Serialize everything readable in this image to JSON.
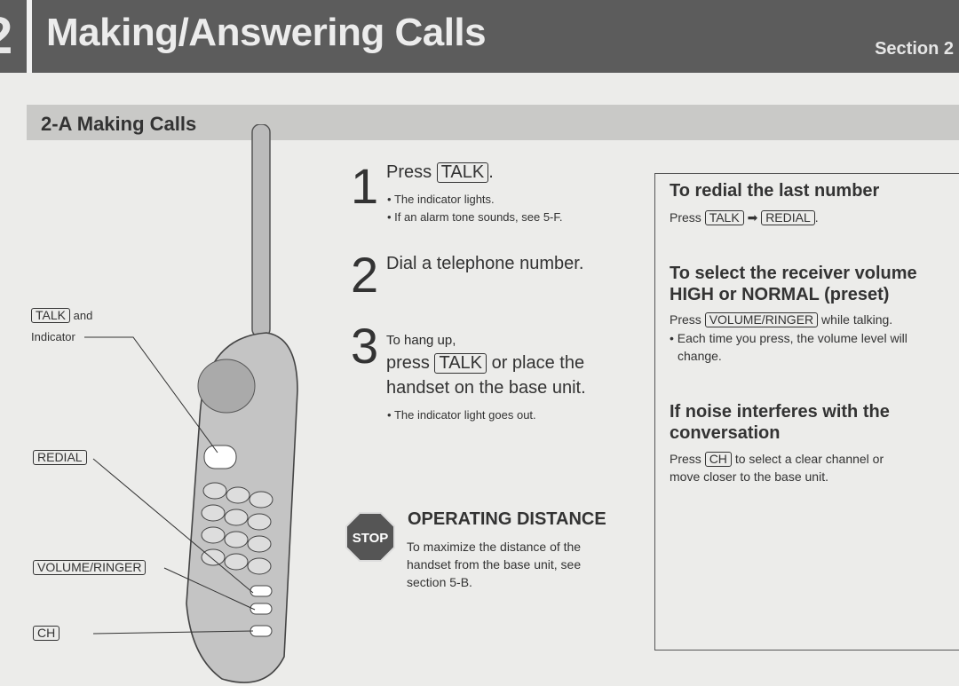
{
  "header": {
    "chapter_number": "2",
    "title": "Making/Answering Calls",
    "section": "Section 2"
  },
  "subheader": {
    "title": "2-A  Making Calls"
  },
  "labels": {
    "talk_key": "TALK",
    "talk_and": "and",
    "indicator": "Indicator",
    "redial_key": "REDIAL",
    "volume_key": "VOLUME/RINGER",
    "ch_key": "CH"
  },
  "steps": [
    {
      "number": "1",
      "pre": "Press",
      "key": "TALK",
      "post": ".",
      "notes": [
        "The indicator lights.",
        "If an alarm tone sounds, see 5-F."
      ]
    },
    {
      "number": "2",
      "text": "Dial a telephone number."
    },
    {
      "number": "3",
      "line1": "To hang up,",
      "pre": "press",
      "key": "TALK",
      "post": "or place the",
      "line3": "handset on the base unit.",
      "notes": [
        "The indicator light goes out."
      ]
    }
  ],
  "operating": {
    "stop_label": "STOP",
    "title": "OPERATING DISTANCE",
    "lines": [
      "To maximize the distance of the",
      "handset from the base unit, see",
      "section 5-B."
    ]
  },
  "box": {
    "redial": {
      "title": "To redial the last number",
      "pre": "Press",
      "key1": "TALK",
      "key2": "REDIAL",
      "post": "."
    },
    "volume": {
      "title1": "To select the receiver volume",
      "title2": "HIGH or NORMAL (preset)",
      "pre": "Press",
      "key": "VOLUME/RINGER",
      "post": "while talking.",
      "note1": "Each time you press, the volume level will",
      "note2": "change."
    },
    "noise": {
      "title1": "If noise interferes with the",
      "title2": "conversation",
      "pre": "Press",
      "key": "CH",
      "post": "to select a clear channel or",
      "line2": "move closer to the base unit."
    }
  }
}
